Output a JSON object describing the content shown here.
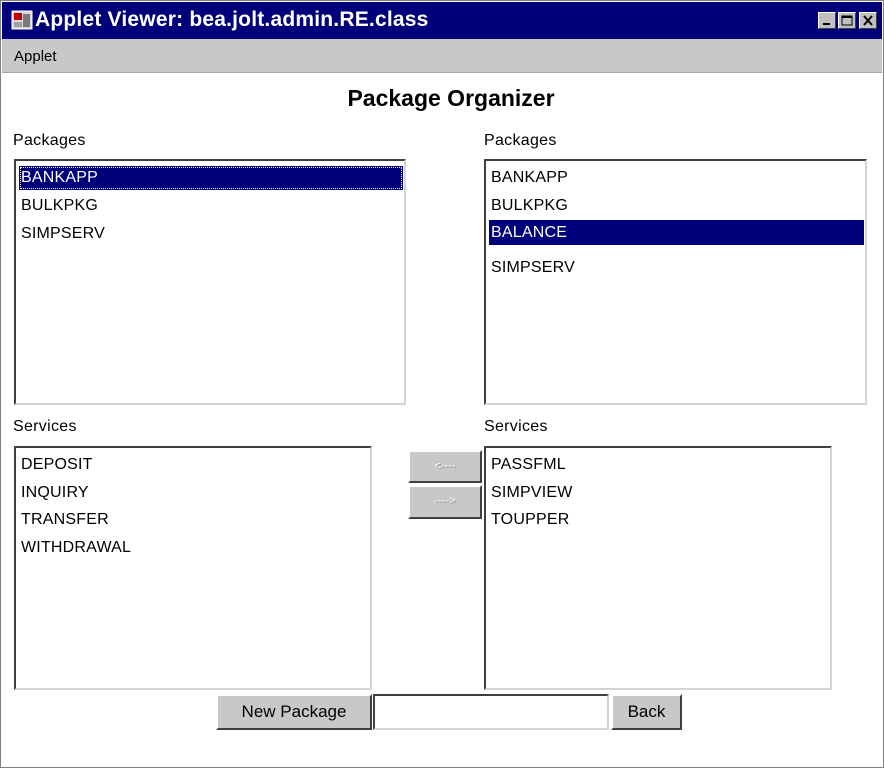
{
  "window": {
    "title": "Applet Viewer: bea.jolt.admin.RE.class"
  },
  "menu": {
    "applet": "Applet"
  },
  "page": {
    "heading": "Package Organizer"
  },
  "left": {
    "packages_label": "Packages",
    "packages": [
      "BANKAPP",
      "BULKPKG",
      "SIMPSERV"
    ],
    "packages_selected": "BANKAPP",
    "services_label": "Services",
    "services": [
      "DEPOSIT",
      "INQUIRY",
      "TRANSFER",
      "WITHDRAWAL"
    ]
  },
  "right": {
    "packages_label": "Packages",
    "packages": [
      "BANKAPP",
      "BULKPKG",
      "BALANCE",
      "SIMPSERV"
    ],
    "packages_selected": "BALANCE",
    "services_label": "Services",
    "services": [
      "PASSFML",
      "SIMPVIEW",
      "TOUPPER"
    ]
  },
  "transfer": {
    "move_left": "<----",
    "move_right": "---->"
  },
  "footer": {
    "new_package": "New Package",
    "package_name_value": "",
    "back": "Back"
  }
}
